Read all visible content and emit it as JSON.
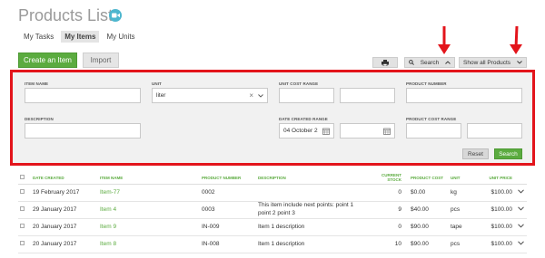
{
  "page": {
    "title": "Products List",
    "video_icon": "video-camera-icon"
  },
  "tabs": [
    {
      "label": "My Tasks",
      "active": false
    },
    {
      "label": "My Items",
      "active": true
    },
    {
      "label": "My Units",
      "active": false
    }
  ],
  "toolbar": {
    "create_label": "Create an Item",
    "import_label": "Import",
    "print_icon": "printer-icon",
    "search_label": "Search",
    "show_all_label": "Show all Products"
  },
  "filters": {
    "item_name": {
      "label": "ITEM NAME",
      "value": ""
    },
    "unit": {
      "label": "UNIT",
      "value": "liter"
    },
    "unit_cost_range": {
      "label": "UNIT COST RANGE",
      "from": "",
      "to": ""
    },
    "product_number": {
      "label": "PRODUCT NUMBER",
      "value": ""
    },
    "description": {
      "label": "DESCRIPTION",
      "value": ""
    },
    "date_created_range": {
      "label": "DATE CREATED RANGE",
      "from": "04 October 2",
      "to": ""
    },
    "product_cost_range": {
      "label": "PRODUCT COST RANGE",
      "from": "",
      "to": ""
    },
    "reset_label": "Reset",
    "search_label": "Search"
  },
  "table": {
    "columns": [
      "DATE CREATED",
      "ITEM NAME",
      "PRODUCT NUMBER",
      "DESCRIPTION",
      "CURRENT STOCK",
      "PRODUCT COST",
      "UNIT",
      "UNIT PRICE"
    ],
    "rows": [
      {
        "date": "19 February 2017",
        "name": "Item-77",
        "number": "0002",
        "description": "",
        "stock": "0",
        "cost": "$0.00",
        "unit": "kg",
        "price": "$100.00"
      },
      {
        "date": "29 January 2017",
        "name": "Item 4",
        "number": "0003",
        "description": "This item include next points: point 1 point 2 point 3",
        "stock": "9",
        "cost": "$40.00",
        "unit": "pcs",
        "price": "$100.00"
      },
      {
        "date": "20 January 2017",
        "name": "Item 9",
        "number": "IN-009",
        "description": "Item 1 description",
        "stock": "0",
        "cost": "$90.00",
        "unit": "tape",
        "price": "$100.00"
      },
      {
        "date": "20 January 2017",
        "name": "Item 8",
        "number": "IN-008",
        "description": "Item 1 description",
        "stock": "10",
        "cost": "$90.00",
        "unit": "pcs",
        "price": "$100.00"
      }
    ]
  },
  "colors": {
    "accent_green": "#5bab3f",
    "highlight_red": "#e3141b",
    "video_icon_blue": "#4db6ce"
  }
}
